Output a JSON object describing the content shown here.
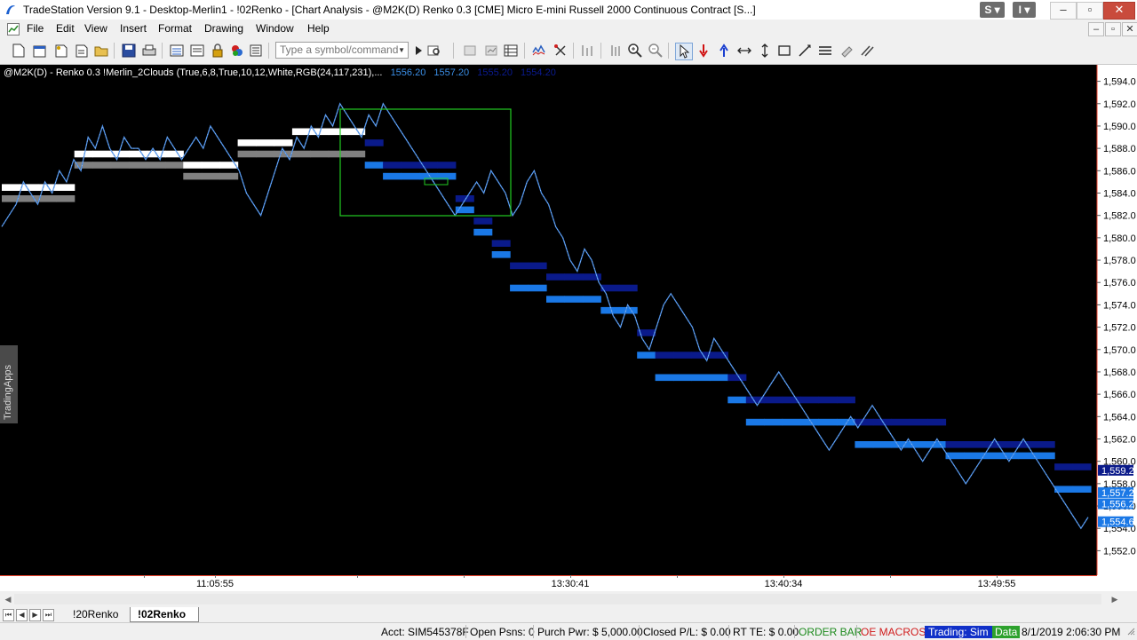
{
  "window": {
    "title": "TradeStation Version 9.1 - Desktop-Merlin1 - !02Renko - [Chart Analysis - @M2K(D) Renko 0.3 [CME] Micro E-mini Russell 2000 Continuous Contract [S...]",
    "s_label": "S",
    "i_label": "I"
  },
  "menu": {
    "items": [
      "File",
      "Edit",
      "View",
      "Insert",
      "Format",
      "Drawing",
      "Window",
      "Help"
    ]
  },
  "toolbar": {
    "symbol_placeholder": "Type a symbol/command"
  },
  "chart": {
    "header_symbol": "@M2K(D) - Renko 0.3  !Merlin_2Clouds (True,6,8,True,10,12,White,RGB(24,117,231),...",
    "header_values": [
      "1556.20",
      "1557.20",
      "1555.20",
      "1554.20"
    ],
    "side_tab": "TradingApps",
    "colors": {
      "background": "#000000",
      "price_line": "#4a8fe8",
      "cloud_white": "#ffffff",
      "cloud_grey": "#808080",
      "cloud_light_blue": "#1a78e6",
      "cloud_dark_blue": "#0a1a8a",
      "selection_box": "#22cc22"
    }
  },
  "chart_data": {
    "type": "line",
    "title": "@M2K(D) - Renko 0.3",
    "xlabel": "",
    "ylabel": "",
    "ylim": [
      1551.0,
      1595.0
    ],
    "y_ticks": [
      "1,594.0",
      "1,592.0",
      "1,590.0",
      "1,588.0",
      "1,586.0",
      "1,584.0",
      "1,582.0",
      "1,580.0",
      "1,578.0",
      "1,576.0",
      "1,574.0",
      "1,572.0",
      "1,570.0",
      "1,568.0",
      "1,566.0",
      "1,564.0",
      "1,562.0",
      "1,560.0",
      "1,558.0",
      "1,556.0",
      "1,554.0",
      "1,552.0"
    ],
    "y_tick_values": [
      1594,
      1592,
      1590,
      1588,
      1586,
      1584,
      1582,
      1580,
      1578,
      1576,
      1574,
      1572,
      1570,
      1568,
      1566,
      1564,
      1562,
      1560,
      1558,
      1556,
      1554,
      1552
    ],
    "x_ticks": [
      "11:05:55",
      "13:30:41",
      "13:40:34",
      "13:49:55"
    ],
    "price_markers": [
      {
        "label": "1,559.2",
        "value": 1559.2,
        "color": "#0a1a8a"
      },
      {
        "label": "1,557.2",
        "value": 1557.2,
        "color": "#1a78e6"
      },
      {
        "label": "1,556.2",
        "value": 1556.2,
        "color": "#1a78e6"
      },
      {
        "label": "1,554.6",
        "value": 1554.6,
        "color": "#1a78e6"
      }
    ],
    "price_series": [
      1581,
      1582,
      1583,
      1585,
      1584,
      1583,
      1585,
      1584,
      1586,
      1585,
      1587,
      1586,
      1589,
      1588,
      1590,
      1588,
      1587,
      1589,
      1588,
      1588,
      1587,
      1588,
      1587,
      1589,
      1588,
      1587,
      1588,
      1589,
      1588,
      1590,
      1589,
      1588,
      1587,
      1586,
      1584,
      1583,
      1582,
      1584,
      1586,
      1588,
      1587,
      1589,
      1588,
      1590,
      1589,
      1591,
      1590,
      1592,
      1591,
      1590,
      1589,
      1591,
      1590,
      1592,
      1591,
      1590,
      1589,
      1588,
      1587,
      1586,
      1585,
      1584,
      1583,
      1582,
      1583,
      1584,
      1585,
      1584,
      1586,
      1585,
      1584,
      1582,
      1583,
      1585,
      1586,
      1584,
      1583,
      1581,
      1580,
      1578,
      1577,
      1579,
      1578,
      1576,
      1575,
      1573,
      1572,
      1574,
      1573,
      1571,
      1570,
      1572,
      1574,
      1575,
      1574,
      1573,
      1572,
      1570,
      1569,
      1571,
      1570,
      1569,
      1568,
      1567,
      1566,
      1565,
      1566,
      1567,
      1568,
      1567,
      1566,
      1565,
      1564,
      1563,
      1562,
      1561,
      1562,
      1563,
      1564,
      1563,
      1564,
      1565,
      1564,
      1563,
      1562,
      1561,
      1562,
      1561,
      1560,
      1561,
      1562,
      1561,
      1560,
      1559,
      1558,
      1559,
      1560,
      1561,
      1562,
      1561,
      1560,
      1561,
      1562,
      1561,
      1560,
      1559,
      1558,
      1557,
      1556,
      1555,
      1554,
      1555
    ],
    "series": [
      {
        "values": [
          1584.2,
          1584.2,
          1584.2,
          1584.2,
          1587.2,
          1587.2,
          1587.2,
          1587.2,
          1587.2,
          1587.2,
          1586.2,
          1586.2,
          1586.2,
          1588.2,
          1588.2,
          1588.2,
          1589.2,
          1589.2,
          1589.2,
          1589.2,
          1588.2,
          1586.2,
          1586.2,
          1586.2,
          1586.2,
          1583.2,
          1581.2,
          1579.2,
          1577.2,
          1577.2,
          1576.2,
          1576.2,
          1576.2,
          1575.2,
          1575.2,
          1571.2,
          1569.2,
          1569.2,
          1569.2,
          1569.2,
          1567.2,
          1565.2,
          1565.2,
          1565.2,
          1565.2,
          1565.2,
          1565.2,
          1563.2,
          1563.2,
          1563.2,
          1563.2,
          1563.2,
          1561.2,
          1561.2,
          1561.2,
          1561.2,
          1561.2,
          1561.2,
          1559.2,
          1559.2
        ]
      },
      {
        "values": [
          1583.2,
          1583.2,
          1583.2,
          1583.2,
          1586.2,
          1586.2,
          1586.2,
          1586.2,
          1586.2,
          1586.2,
          1585.2,
          1585.2,
          1585.2,
          1587.2,
          1587.2,
          1587.2,
          1587.2,
          1587.2,
          1587.2,
          1587.2,
          1586.2,
          1585.2,
          1585.2,
          1585.2,
          1585.2,
          1582.2,
          1580.2,
          1578.2,
          1575.2,
          1575.2,
          1574.2,
          1574.2,
          1574.2,
          1573.2,
          1573.2,
          1569.2,
          1567.2,
          1567.2,
          1567.2,
          1567.2,
          1565.2,
          1563.2,
          1563.2,
          1563.2,
          1563.2,
          1563.2,
          1563.2,
          1561.2,
          1561.2,
          1561.2,
          1561.2,
          1561.2,
          1560.2,
          1560.2,
          1560.2,
          1560.2,
          1560.2,
          1560.2,
          1557.2,
          1557.2
        ]
      }
    ],
    "grid": false,
    "legend": "none"
  },
  "status": {
    "acct": "Acct: SIM545378F",
    "open_psns": "Open Psns: 0",
    "purch_pwr": "Purch Pwr: $ 5,000.00",
    "closed_pl": "Closed P/L: $ 0.00",
    "rt_te": "RT TE: $ 0.00",
    "order_bar": "ORDER BAR",
    "oe_macros": "OE MACROS",
    "trading": "Trading: Sim",
    "data": "Data",
    "datetime": "8/1/2019 2:06:30 PM"
  },
  "tabs": {
    "items": [
      "!20Renko",
      "!02Renko"
    ],
    "active": "!02Renko"
  }
}
